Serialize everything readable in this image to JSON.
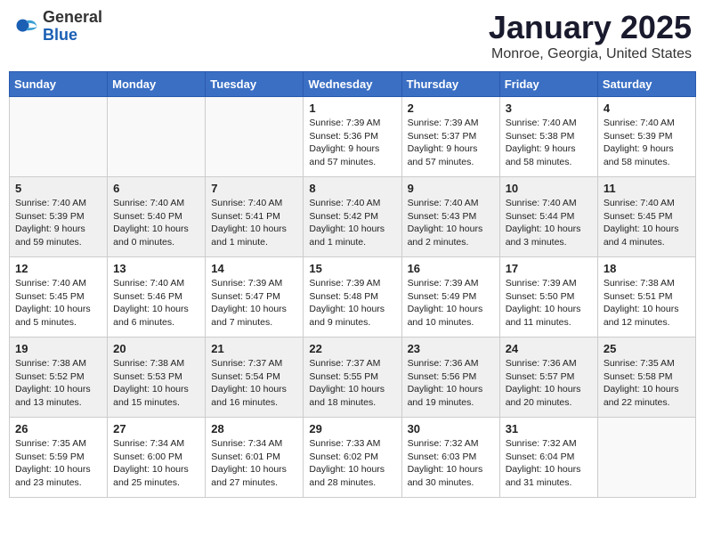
{
  "header": {
    "logo_general": "General",
    "logo_blue": "Blue",
    "month_title": "January 2025",
    "location": "Monroe, Georgia, United States"
  },
  "weekdays": [
    "Sunday",
    "Monday",
    "Tuesday",
    "Wednesday",
    "Thursday",
    "Friday",
    "Saturday"
  ],
  "weeks": [
    [
      {
        "day": "",
        "info": ""
      },
      {
        "day": "",
        "info": ""
      },
      {
        "day": "",
        "info": ""
      },
      {
        "day": "1",
        "info": "Sunrise: 7:39 AM\nSunset: 5:36 PM\nDaylight: 9 hours\nand 57 minutes."
      },
      {
        "day": "2",
        "info": "Sunrise: 7:39 AM\nSunset: 5:37 PM\nDaylight: 9 hours\nand 57 minutes."
      },
      {
        "day": "3",
        "info": "Sunrise: 7:40 AM\nSunset: 5:38 PM\nDaylight: 9 hours\nand 58 minutes."
      },
      {
        "day": "4",
        "info": "Sunrise: 7:40 AM\nSunset: 5:39 PM\nDaylight: 9 hours\nand 58 minutes."
      }
    ],
    [
      {
        "day": "5",
        "info": "Sunrise: 7:40 AM\nSunset: 5:39 PM\nDaylight: 9 hours\nand 59 minutes."
      },
      {
        "day": "6",
        "info": "Sunrise: 7:40 AM\nSunset: 5:40 PM\nDaylight: 10 hours\nand 0 minutes."
      },
      {
        "day": "7",
        "info": "Sunrise: 7:40 AM\nSunset: 5:41 PM\nDaylight: 10 hours\nand 1 minute."
      },
      {
        "day": "8",
        "info": "Sunrise: 7:40 AM\nSunset: 5:42 PM\nDaylight: 10 hours\nand 1 minute."
      },
      {
        "day": "9",
        "info": "Sunrise: 7:40 AM\nSunset: 5:43 PM\nDaylight: 10 hours\nand 2 minutes."
      },
      {
        "day": "10",
        "info": "Sunrise: 7:40 AM\nSunset: 5:44 PM\nDaylight: 10 hours\nand 3 minutes."
      },
      {
        "day": "11",
        "info": "Sunrise: 7:40 AM\nSunset: 5:45 PM\nDaylight: 10 hours\nand 4 minutes."
      }
    ],
    [
      {
        "day": "12",
        "info": "Sunrise: 7:40 AM\nSunset: 5:45 PM\nDaylight: 10 hours\nand 5 minutes."
      },
      {
        "day": "13",
        "info": "Sunrise: 7:40 AM\nSunset: 5:46 PM\nDaylight: 10 hours\nand 6 minutes."
      },
      {
        "day": "14",
        "info": "Sunrise: 7:39 AM\nSunset: 5:47 PM\nDaylight: 10 hours\nand 7 minutes."
      },
      {
        "day": "15",
        "info": "Sunrise: 7:39 AM\nSunset: 5:48 PM\nDaylight: 10 hours\nand 9 minutes."
      },
      {
        "day": "16",
        "info": "Sunrise: 7:39 AM\nSunset: 5:49 PM\nDaylight: 10 hours\nand 10 minutes."
      },
      {
        "day": "17",
        "info": "Sunrise: 7:39 AM\nSunset: 5:50 PM\nDaylight: 10 hours\nand 11 minutes."
      },
      {
        "day": "18",
        "info": "Sunrise: 7:38 AM\nSunset: 5:51 PM\nDaylight: 10 hours\nand 12 minutes."
      }
    ],
    [
      {
        "day": "19",
        "info": "Sunrise: 7:38 AM\nSunset: 5:52 PM\nDaylight: 10 hours\nand 13 minutes."
      },
      {
        "day": "20",
        "info": "Sunrise: 7:38 AM\nSunset: 5:53 PM\nDaylight: 10 hours\nand 15 minutes."
      },
      {
        "day": "21",
        "info": "Sunrise: 7:37 AM\nSunset: 5:54 PM\nDaylight: 10 hours\nand 16 minutes."
      },
      {
        "day": "22",
        "info": "Sunrise: 7:37 AM\nSunset: 5:55 PM\nDaylight: 10 hours\nand 18 minutes."
      },
      {
        "day": "23",
        "info": "Sunrise: 7:36 AM\nSunset: 5:56 PM\nDaylight: 10 hours\nand 19 minutes."
      },
      {
        "day": "24",
        "info": "Sunrise: 7:36 AM\nSunset: 5:57 PM\nDaylight: 10 hours\nand 20 minutes."
      },
      {
        "day": "25",
        "info": "Sunrise: 7:35 AM\nSunset: 5:58 PM\nDaylight: 10 hours\nand 22 minutes."
      }
    ],
    [
      {
        "day": "26",
        "info": "Sunrise: 7:35 AM\nSunset: 5:59 PM\nDaylight: 10 hours\nand 23 minutes."
      },
      {
        "day": "27",
        "info": "Sunrise: 7:34 AM\nSunset: 6:00 PM\nDaylight: 10 hours\nand 25 minutes."
      },
      {
        "day": "28",
        "info": "Sunrise: 7:34 AM\nSunset: 6:01 PM\nDaylight: 10 hours\nand 27 minutes."
      },
      {
        "day": "29",
        "info": "Sunrise: 7:33 AM\nSunset: 6:02 PM\nDaylight: 10 hours\nand 28 minutes."
      },
      {
        "day": "30",
        "info": "Sunrise: 7:32 AM\nSunset: 6:03 PM\nDaylight: 10 hours\nand 30 minutes."
      },
      {
        "day": "31",
        "info": "Sunrise: 7:32 AM\nSunset: 6:04 PM\nDaylight: 10 hours\nand 31 minutes."
      },
      {
        "day": "",
        "info": ""
      }
    ]
  ]
}
